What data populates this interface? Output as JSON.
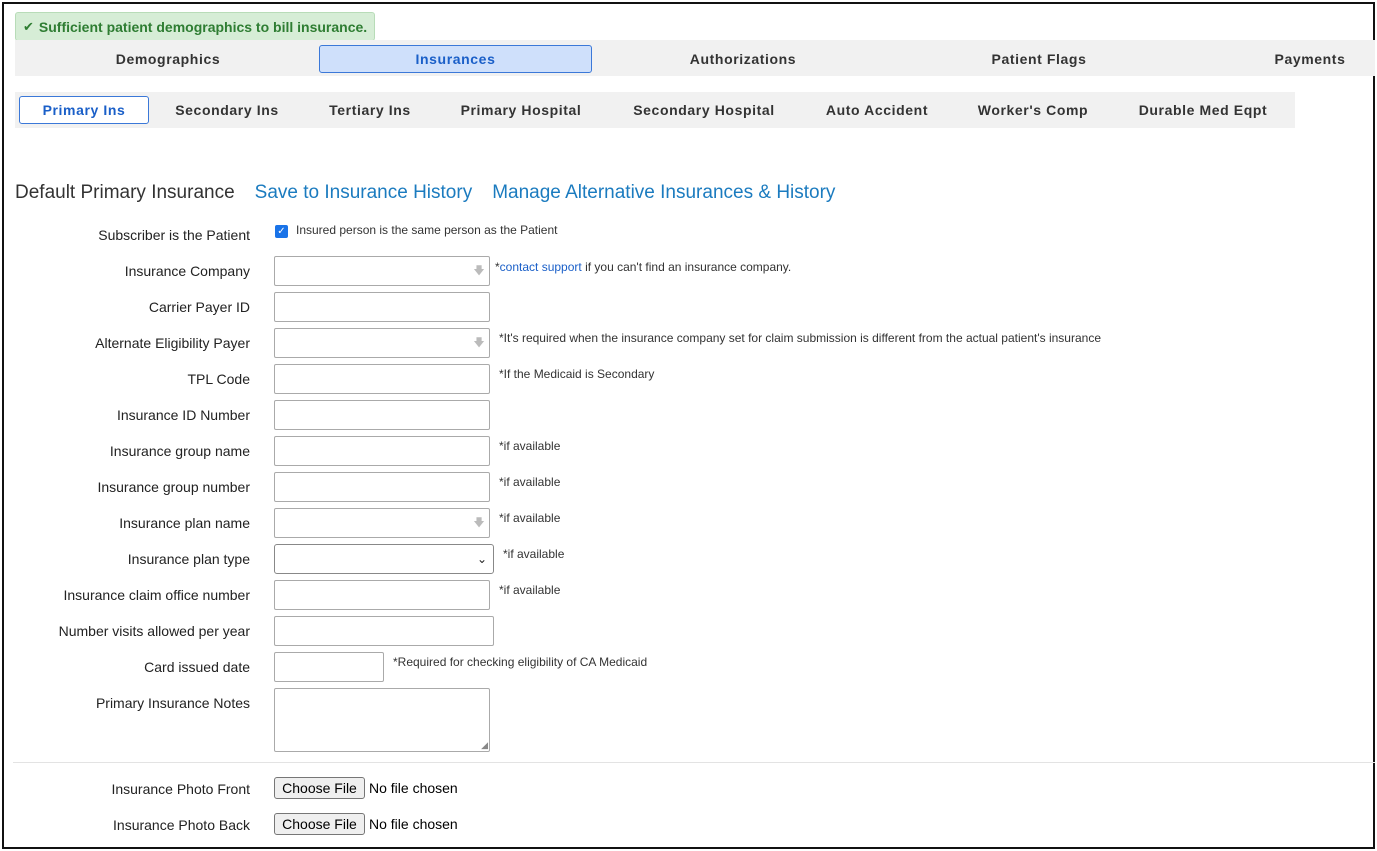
{
  "alert": {
    "icon": "check-icon",
    "text": "Sufficient patient demographics to bill insurance."
  },
  "main_tabs": [
    "Demographics",
    "Insurances",
    "Authorizations",
    "Patient Flags",
    "Payments"
  ],
  "main_tabs_active": "Insurances",
  "sub_tabs": [
    "Primary Ins",
    "Secondary Ins",
    "Tertiary Ins",
    "Primary Hospital",
    "Secondary Hospital",
    "Auto Accident",
    "Worker's Comp",
    "Durable Med Eqpt"
  ],
  "sub_tabs_active": "Primary Ins",
  "section": {
    "title": "Default Primary Insurance",
    "link_save": "Save to Insurance History",
    "link_manage": "Manage Alternative Insurances & History"
  },
  "fields": {
    "subscriber": {
      "label": "Subscriber is the Patient",
      "checked": true,
      "checkbox_label": "Insured person is the same person as the Patient"
    },
    "insurance_company": {
      "label": "Insurance Company",
      "value": "",
      "hint_prefix": "*",
      "hint_link": "contact support",
      "hint_suffix": " if you can't find an insurance company."
    },
    "carrier_payer_id": {
      "label": "Carrier Payer ID",
      "value": ""
    },
    "alt_eligibility_payer": {
      "label": "Alternate Eligibility Payer",
      "value": "",
      "hint": "*It's required when the insurance company set for claim submission is different from the actual patient's insurance"
    },
    "tpl_code": {
      "label": "TPL Code",
      "value": "",
      "hint": "*If the Medicaid is Secondary"
    },
    "insurance_id": {
      "label": "Insurance ID Number",
      "value": ""
    },
    "group_name": {
      "label": "Insurance group name",
      "value": "",
      "hint": "*if available"
    },
    "group_number": {
      "label": "Insurance group number",
      "value": "",
      "hint": "*if available"
    },
    "plan_name": {
      "label": "Insurance plan name",
      "value": "",
      "hint": "*if available"
    },
    "plan_type": {
      "label": "Insurance plan type",
      "value": "",
      "hint": "*if available"
    },
    "claim_office_number": {
      "label": "Insurance claim office number",
      "value": "",
      "hint": "*if available"
    },
    "visits_allowed": {
      "label": "Number visits allowed per year",
      "value": ""
    },
    "card_issued_date": {
      "label": "Card issued date",
      "value": "",
      "hint": "*Required for checking eligibility of CA Medicaid"
    },
    "notes": {
      "label": "Primary Insurance Notes",
      "value": ""
    }
  },
  "uploads": {
    "front": {
      "label": "Insurance Photo Front",
      "button": "Choose File",
      "status": "No file chosen"
    },
    "back": {
      "label": "Insurance Photo Back",
      "button": "Choose File",
      "status": "No file chosen"
    }
  },
  "colors": {
    "accent": "#1a5fc8",
    "link": "#1b7bbf",
    "success_bg": "#d6edd6",
    "success_text": "#2e7d32"
  }
}
